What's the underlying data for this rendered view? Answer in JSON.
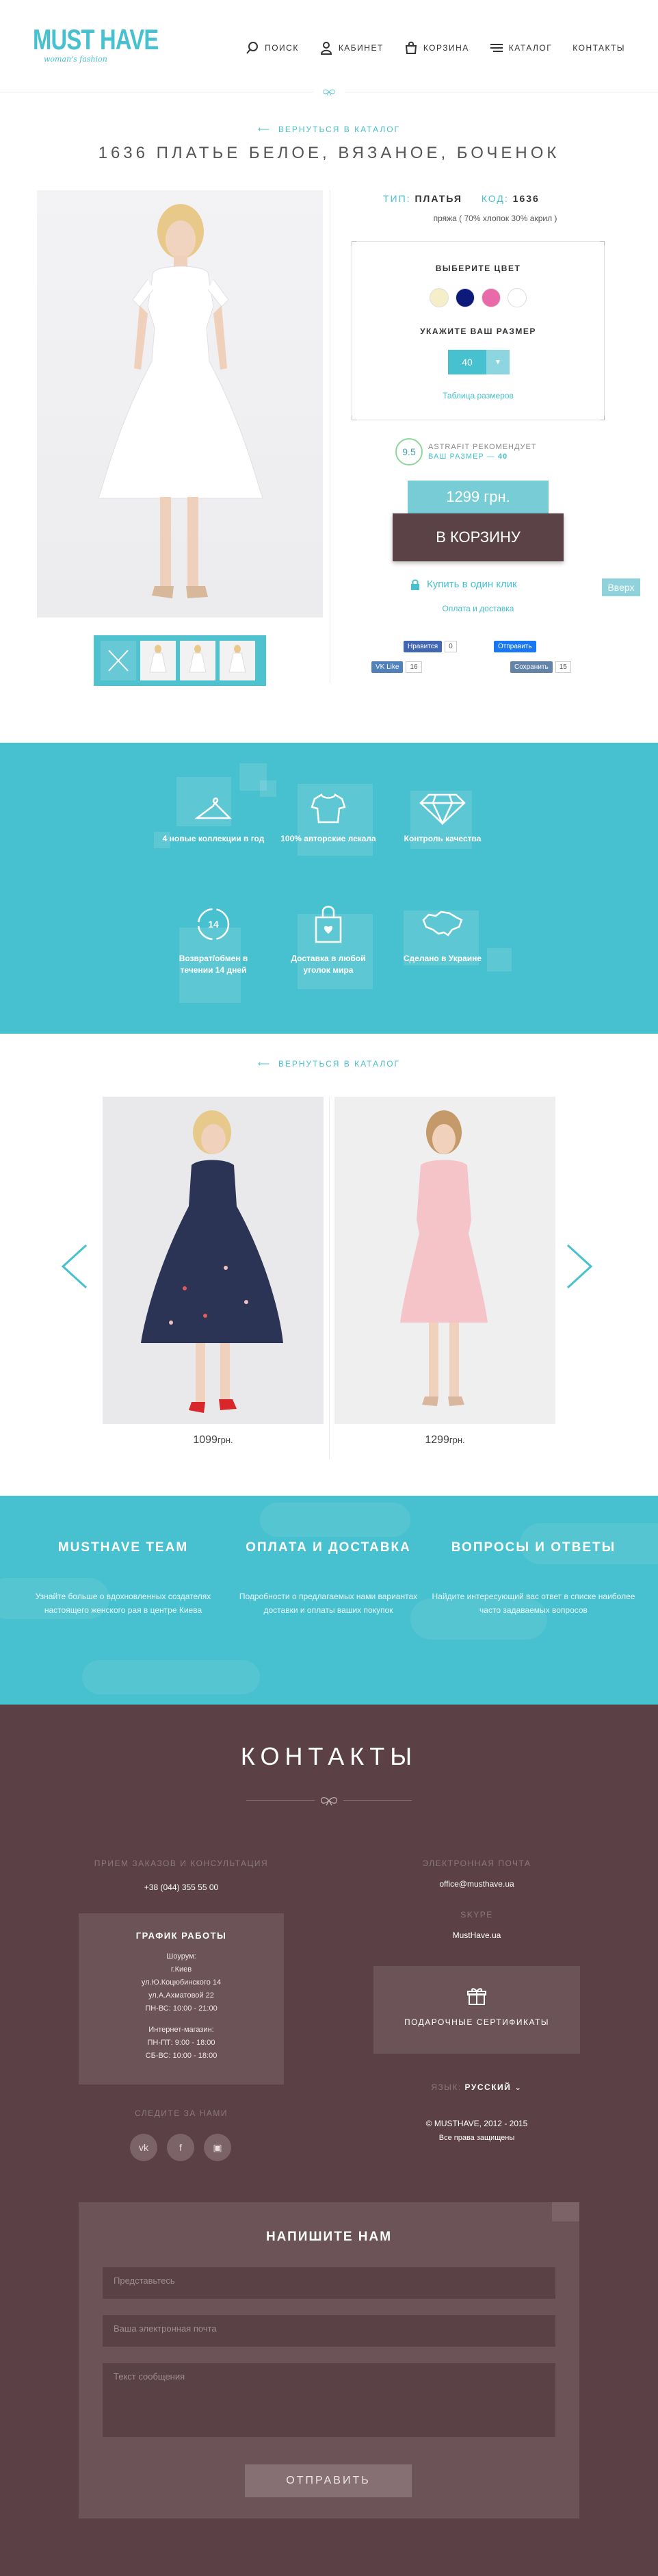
{
  "header": {
    "logo": "MUST HAVE",
    "logo_tagline": "woman's fashion",
    "nav": [
      {
        "label": "ПОИСК"
      },
      {
        "label": "КАБИНЕТ"
      },
      {
        "label": "КОРЗИНА"
      },
      {
        "label": "КАТАЛОГ"
      },
      {
        "label": "КОНТАКТЫ"
      }
    ]
  },
  "product": {
    "back_link": "ВЕРНУТЬСЯ В КАТАЛОГ",
    "title": "1636 ПЛАТЬЕ БЕЛОЕ, ВЯЗАНОЕ, БОЧЕНОК",
    "type_label": "ТИП:",
    "type_value": "ПЛАТЬЯ",
    "code_label": "КОД:",
    "code_value": "1636",
    "fabric": "пряжа ( 70% хлопок 30% акрил )",
    "choose_color": "ВЫБЕРИТЕ ЦВЕТ",
    "colors": [
      "#f5efc9",
      "#0d1a7a",
      "#e86aa8",
      "#ffffff"
    ],
    "choose_size": "УКАЖИТЕ ВАШ РАЗМЕР",
    "size": "40",
    "size_table": "Таблица размеров",
    "rec_score": "9.5",
    "rec_line1": "ASTRAFIT РЕКОМЕНДУЕТ",
    "rec_line2": "ВАШ РАЗМЕР — ",
    "rec_size": "40",
    "price": "1299 грн.",
    "cart_button": "В КОРЗИНУ",
    "one_click": "Купить в один клик",
    "payment": "Оплата и доставка",
    "top_button": "Вверх",
    "social": {
      "fb_like": "Нравится",
      "fb_like_count": "0",
      "fb_send": "Отправить",
      "vk_like": "Like",
      "vk_count": "16",
      "save": "Сохранить",
      "save_count": "15"
    }
  },
  "features": [
    {
      "icon": "hanger-icon",
      "label": "4 новые коллекции в год"
    },
    {
      "icon": "shirt-icon",
      "label": "100% авторские лекала"
    },
    {
      "icon": "diamond-icon",
      "label": "Контроль качества"
    },
    {
      "icon": "return-14-icon",
      "badge": "14",
      "label": "Возврат/обмен в течении 14 дней"
    },
    {
      "icon": "shopping-bag-icon",
      "label": "Доставка в любой уголок мира"
    },
    {
      "icon": "ukraine-map-icon",
      "label": "Сделано в Украине"
    }
  ],
  "related": {
    "back_link": "ВЕРНУТЬСЯ В КАТАЛОГ",
    "items": [
      {
        "price": "1099",
        "currency": "грн."
      },
      {
        "price": "1299",
        "currency": "грн."
      }
    ]
  },
  "info": [
    {
      "title": "MUSTHAVE TEAM",
      "text": "Узнайте больше о вдохновленных создателях настоящего женского рая в центре Киева"
    },
    {
      "title": "ОПЛАТА И ДОСТАВКА",
      "text": "Подробности о предлагаемых нами вариантах доставки и оплаты ваших покупок"
    },
    {
      "title": "ВОПРОСЫ И ОТВЕТЫ",
      "text": "Найдите интересующий вас ответ в списке наиболее часто задаваемых вопросов"
    }
  ],
  "contacts": {
    "title": "КОНТАКТЫ",
    "orders_label": "ПРИЕМ ЗАКАЗОВ И КОНСУЛЬТАЦИЯ",
    "phone": "+38 (044) 355 55 00",
    "schedule_title": "ГРАФИК РАБОТЫ",
    "schedule_showroom": [
      "Шоурум:",
      "г.Киев",
      "ул.Ю.Коцюбинского 14",
      "ул.А.Ахматовой 22",
      "ПН-ВС: 10:00 - 21:00"
    ],
    "schedule_shop": [
      "Интернет-магазин:",
      "ПН-ПТ: 9:00 - 18:00",
      "СБ-ВС: 10:00 - 18:00"
    ],
    "follow_label": "СЛЕДИТЕ ЗА НАМИ",
    "email_label": "ЭЛЕКТРОННАЯ ПОЧТА",
    "email": "office@musthave.ua",
    "skype_label": "SKYPE",
    "skype": "MustHave.ua",
    "certificates": "ПОДАРОЧНЫЕ СЕРТИФИКАТЫ",
    "lang_label": "ЯЗЫК:",
    "lang_value": "РУССКИЙ",
    "copyright": "© MUSTHAVE, 2012 - 2015",
    "rights": "Все права защищены"
  },
  "form": {
    "title": "НАПИШИТЕ НАМ",
    "name_placeholder": "Представьтесь",
    "email_placeholder": "Ваша электронная почта",
    "message_placeholder": "Текст сообщения",
    "send": "ОТПРАВИТЬ"
  }
}
